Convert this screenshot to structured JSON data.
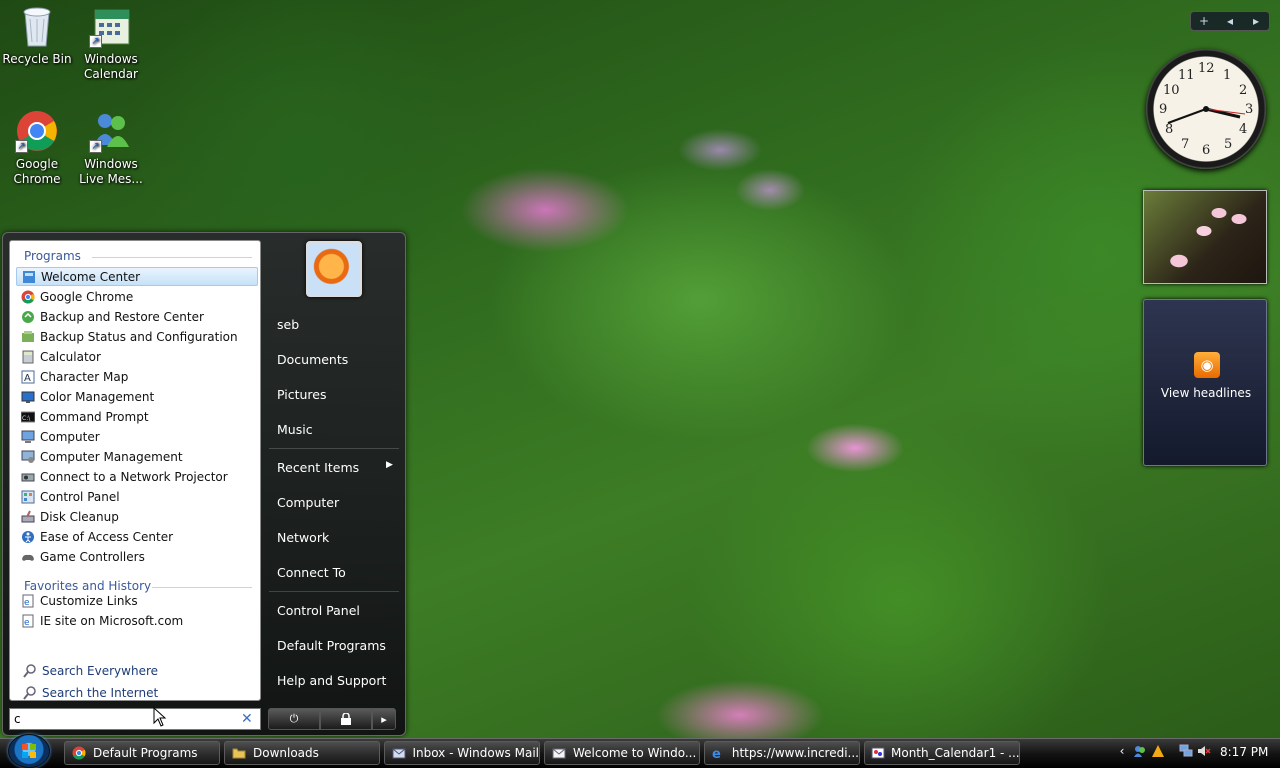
{
  "desktop": {
    "icons": [
      {
        "label": "Recycle Bin",
        "icon": "recycle-bin-icon"
      },
      {
        "label": "Windows Calendar",
        "icon": "calendar-icon"
      },
      {
        "label": "Google Chrome",
        "icon": "chrome-icon"
      },
      {
        "label": "Windows Live Mes...",
        "icon": "messenger-icon"
      }
    ]
  },
  "start_menu": {
    "programs_header": "Programs",
    "programs": [
      {
        "label": "Welcome Center",
        "icon": "welcome-center-icon"
      },
      {
        "label": "Google Chrome",
        "icon": "chrome-icon"
      },
      {
        "label": "Backup and Restore Center",
        "icon": "backup-icon"
      },
      {
        "label": "Backup Status and Configuration",
        "icon": "backup-status-icon"
      },
      {
        "label": "Calculator",
        "icon": "calculator-icon"
      },
      {
        "label": "Character Map",
        "icon": "character-map-icon"
      },
      {
        "label": "Color Management",
        "icon": "color-management-icon"
      },
      {
        "label": "Command Prompt",
        "icon": "command-prompt-icon"
      },
      {
        "label": "Computer",
        "icon": "computer-icon"
      },
      {
        "label": "Computer Management",
        "icon": "computer-management-icon"
      },
      {
        "label": "Connect to a Network Projector",
        "icon": "network-projector-icon"
      },
      {
        "label": "Control Panel",
        "icon": "control-panel-icon"
      },
      {
        "label": "Disk Cleanup",
        "icon": "disk-cleanup-icon"
      },
      {
        "label": "Ease of Access Center",
        "icon": "ease-of-access-icon"
      },
      {
        "label": "Game Controllers",
        "icon": "game-controllers-icon"
      }
    ],
    "favorites_header": "Favorites and History",
    "favorites": [
      {
        "label": "Customize Links",
        "icon": "ie-page-icon"
      },
      {
        "label": "IE site on Microsoft.com",
        "icon": "ie-page-icon"
      }
    ],
    "search_links": [
      {
        "label": "Search Everywhere",
        "icon": "search-icon"
      },
      {
        "label": "Search the Internet",
        "icon": "search-icon"
      }
    ],
    "search_value": "c",
    "right_items": [
      {
        "label": "seb"
      },
      {
        "label": "Documents"
      },
      {
        "label": "Pictures"
      },
      {
        "label": "Music"
      },
      {
        "label": "Recent Items"
      },
      {
        "label": "Computer"
      },
      {
        "label": "Network"
      },
      {
        "label": "Connect To"
      },
      {
        "label": "Control Panel"
      },
      {
        "label": "Default Programs"
      },
      {
        "label": "Help and Support"
      }
    ]
  },
  "taskbar": {
    "buttons": [
      {
        "label": "Default Programs",
        "icon": "chrome-icon"
      },
      {
        "label": "Downloads",
        "icon": "folder-icon"
      },
      {
        "label": "Inbox - Windows Mail",
        "icon": "mail-icon"
      },
      {
        "label": "Welcome to Windo...",
        "icon": "mail-message-icon"
      },
      {
        "label": "https://www.incredi...",
        "icon": "internet-explorer-icon"
      },
      {
        "label": "Month_Calendar1 - ...",
        "icon": "paint-icon"
      }
    ],
    "clock": "8:17 PM"
  },
  "sidebar": {
    "controls": {
      "add": "+",
      "prev": "◂",
      "next": "▸"
    },
    "clock_numbers": [
      "12",
      "1",
      "2",
      "3",
      "4",
      "5",
      "6",
      "7",
      "8",
      "9",
      "10",
      "11"
    ],
    "feed_label": "View headlines"
  },
  "colors": {
    "selection": "#c6e1f8",
    "header_text": "#3a5a9a",
    "link_text": "#1f3c78"
  }
}
